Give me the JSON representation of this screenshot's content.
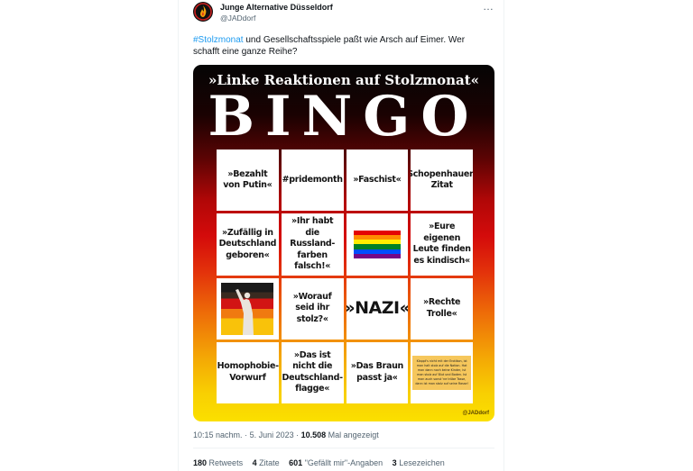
{
  "tweet": {
    "author_name": "Junge Alternative Düsseldorf",
    "author_handle": "@JADdorf",
    "more_icon": "…",
    "hashtag": "#Stolzmonat",
    "text": " und Gesellschaftsspiele paßt wie Arsch auf Eimer. Wer schafft eine ganze Reihe?",
    "time": "10:15 nachm.",
    "date": "5. Juni 2023",
    "views_count": "10.508",
    "views_label": "Mal angezeigt"
  },
  "image": {
    "title": "»Linke Reaktionen auf Stolzmonat«",
    "headline": "BINGO",
    "watermark": "@JADdorf",
    "cells": [
      "»Bezahlt von Putin«",
      "#pridemonth",
      "»Faschist«",
      "Schopenhauer-Zitat",
      "»Zufällig in Deutschland geboren«",
      "»Ihr habt die Russland-farben falsch!«",
      "",
      "»Eure eigenen Leute finden es kindisch«",
      "",
      "»Worauf seid ihr stolz?«",
      "»NAZI«",
      "»Rechte Trolle«",
      "Homophobie-Vorwurf",
      "»Das ist nicht die Deutschland-flagge«",
      "»Das Braun passt ja«",
      "Klappt's nicht mit der Erotikon, ist man halt stolz auf die Nation. Hat man dann noch keine Kinder, ist man stolz auf Blut und Boden. Ist man auch sonst 'ne trübe Tasse, dann ist man stolz auf seine Rasse!"
    ],
    "pride_flag_colors": [
      "#e40303",
      "#ff8c00",
      "#ffed00",
      "#008026",
      "#004dff",
      "#750787"
    ]
  },
  "stats": {
    "retweets_count": "180",
    "retweets_label": "Retweets",
    "quotes_count": "4",
    "quotes_label": "Zitate",
    "likes_count": "601",
    "likes_label": "\"Gefällt mir\"-Angaben",
    "bookmarks_count": "3",
    "bookmarks_label": "Lesezeichen"
  }
}
